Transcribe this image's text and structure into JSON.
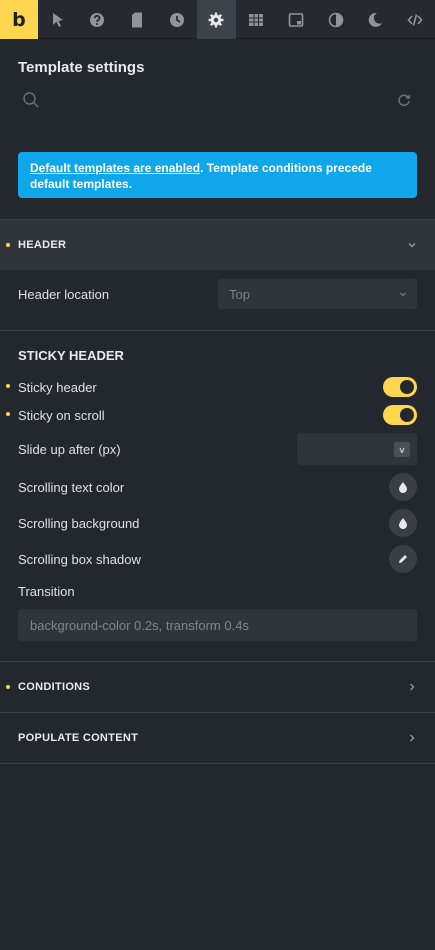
{
  "toolbar": {
    "logo": "b",
    "icons": [
      "cursor-icon",
      "help-icon",
      "page-icon",
      "history-icon",
      "gear-icon",
      "grid-icon",
      "template-icon",
      "contrast-icon",
      "moon-icon",
      "code-icon"
    ],
    "active": "gear-icon"
  },
  "panel": {
    "title": "Template settings",
    "search": {
      "value": "",
      "placeholder": ""
    }
  },
  "notice": {
    "link_text": "Default templates are enabled",
    "text": ". Template conditions precede default templates."
  },
  "header_section": {
    "title": "HEADER",
    "modified": true,
    "header_location": {
      "label": "Header location",
      "value": "Top"
    }
  },
  "sticky": {
    "title": "STICKY HEADER",
    "sticky_header": {
      "label": "Sticky header",
      "enabled": true,
      "modified": true
    },
    "sticky_on_scroll": {
      "label": "Sticky on scroll",
      "enabled": true,
      "modified": true
    },
    "slide_up": {
      "label": "Slide up after (px)",
      "value": "",
      "unit": "v"
    },
    "scrolling_text_color": {
      "label": "Scrolling text color"
    },
    "scrolling_background": {
      "label": "Scrolling background"
    },
    "scrolling_box_shadow": {
      "label": "Scrolling box shadow"
    },
    "transition": {
      "label": "Transition",
      "placeholder": "background-color 0.2s, transform 0.4s"
    }
  },
  "conditions": {
    "title": "CONDITIONS",
    "modified": true
  },
  "populate": {
    "title": "POPULATE CONTENT"
  },
  "colors": {
    "accent": "#ffd64f",
    "notice": "#0fa7ea",
    "background": "#23272e",
    "panel": "#30353c"
  }
}
